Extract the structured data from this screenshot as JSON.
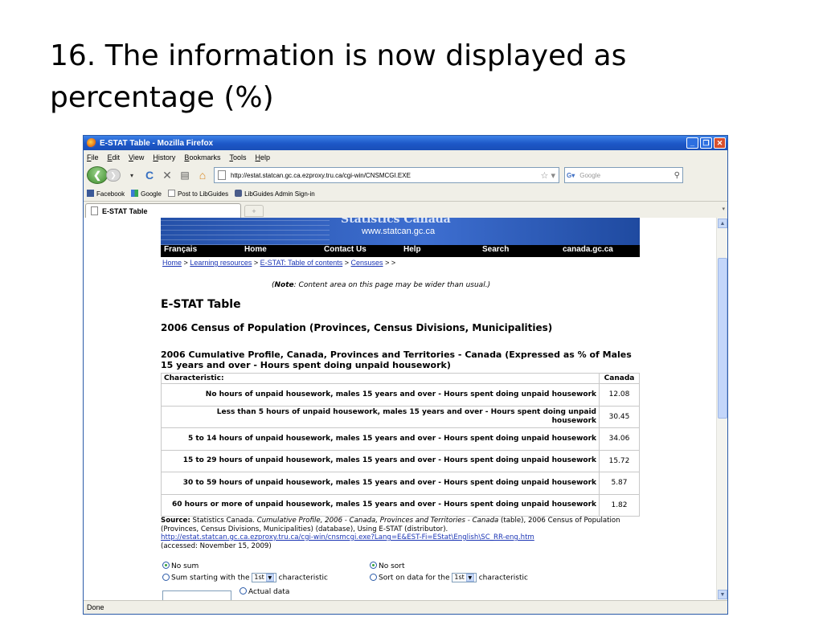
{
  "slide": {
    "title_line1": "16. The information is now displayed as",
    "title_line2": "percentage (%)"
  },
  "browser": {
    "window_title": "E-STAT Table - Mozilla Firefox",
    "menu": [
      "File",
      "Edit",
      "View",
      "History",
      "Bookmarks",
      "Tools",
      "Help"
    ],
    "url": "http://estat.statcan.gc.ca.ezproxy.tru.ca/cgi-win/CNSMCGI.EXE",
    "search_placeholder": "Google",
    "bookmarks": [
      "Facebook",
      "Google",
      "Post to LibGuides",
      "LibGuides Admin Sign-in"
    ],
    "tab_label": "E-STAT Table",
    "status": "Done",
    "accent_color": "#1c57c7"
  },
  "page": {
    "banner_title": "Statistics Canada",
    "banner_url": "www.statcan.gc.ca",
    "nav": [
      "Français",
      "Home",
      "Contact Us",
      "Help",
      "Search",
      "canada.gc.ca"
    ],
    "breadcrumb": {
      "home": "Home",
      "learning": "Learning resources",
      "toc": "E-STAT: Table of contents",
      "censuses": "Censuses",
      "sep": ">",
      "tail": "> >"
    },
    "note_bold": "Note",
    "note_text": ": Content area on this page may be wider than usual.",
    "heading": "E-STAT Table",
    "subheading": "2006 Census of Population (Provinces, Census Divisions, Municipalities)",
    "profile_heading": "2006 Cumulative Profile, Canada, Provinces and Territories - Canada (Expressed as % of Males 15 years and over - Hours spent doing unpaid housework)",
    "table": {
      "col_characteristic": "Characteristic:",
      "col_canada": "Canada",
      "rows": [
        {
          "label": "No hours of unpaid housework, males 15 years and over - Hours spent doing unpaid housework",
          "value": "12.08"
        },
        {
          "label": "Less than 5 hours of unpaid housework, males 15 years and over - Hours spent doing unpaid housework",
          "value": "30.45"
        },
        {
          "label": "5 to 14 hours of unpaid housework, males 15 years and over - Hours spent doing unpaid housework",
          "value": "34.06"
        },
        {
          "label": "15 to 29 hours of unpaid housework, males 15 years and over - Hours spent doing unpaid housework",
          "value": "15.72"
        },
        {
          "label": "30 to 59 hours of unpaid housework, males 15 years and over - Hours spent doing unpaid housework",
          "value": "5.87"
        },
        {
          "label": "60 hours or more of unpaid housework, males 15 years and over - Hours spent doing unpaid housework",
          "value": "1.82"
        }
      ]
    },
    "source": {
      "label": "Source:",
      "text1": " Statistics Canada. ",
      "italic": "Cumulative Profile, 2006 - Canada, Provinces and Territories - Canada",
      "text2": " (table), 2006 Census of Population (Provinces, Census Divisions, Municipalities) (database), Using E-STAT (distributor).",
      "link": "http://estat.statcan.gc.ca.ezproxy.tru.ca/cgi-win/cnsmcgi.exe?Lang=E&EST-Fi=EStat\\English\\SC_RR-eng.htm",
      "accessed": "(accessed: November 15, 2009)"
    },
    "form": {
      "no_sum": "No sum",
      "sum_starting": "Sum starting with the",
      "sum_select": "1st",
      "characteristic": "characteristic",
      "no_sort": "No sort",
      "sort_on": "Sort on data for the",
      "sort_select": "1st",
      "actual_data": "Actual data"
    }
  }
}
